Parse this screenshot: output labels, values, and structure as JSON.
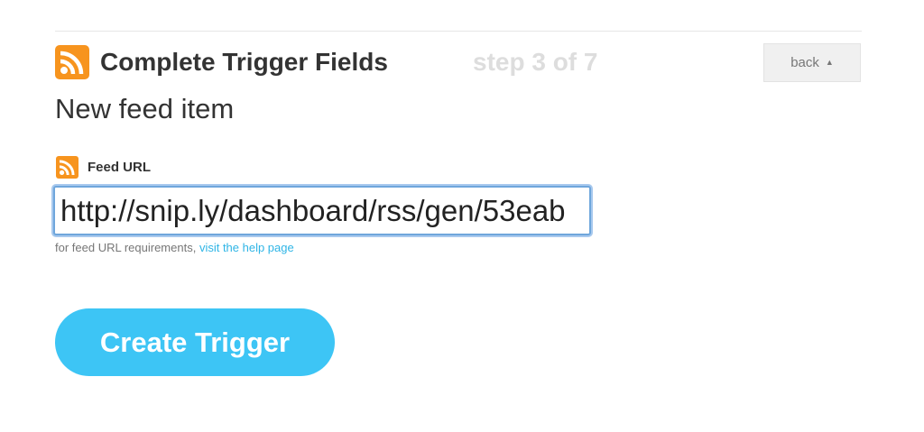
{
  "header": {
    "title": "Complete Trigger Fields",
    "step": "step 3 of 7",
    "back_label": "back",
    "back_caret": "▲"
  },
  "trigger": {
    "name": "New feed item"
  },
  "field": {
    "label": "Feed URL",
    "value": "http://snip.ly/dashboard/rss/gen/53eab",
    "help_text": "for feed URL requirements, ",
    "help_link": "visit the help page"
  },
  "actions": {
    "create_label": "Create Trigger"
  },
  "colors": {
    "rss_orange": "#f7941e",
    "button_blue": "#3dc5f5",
    "link_blue": "#2fb5e6",
    "step_gray": "#dddddd"
  }
}
